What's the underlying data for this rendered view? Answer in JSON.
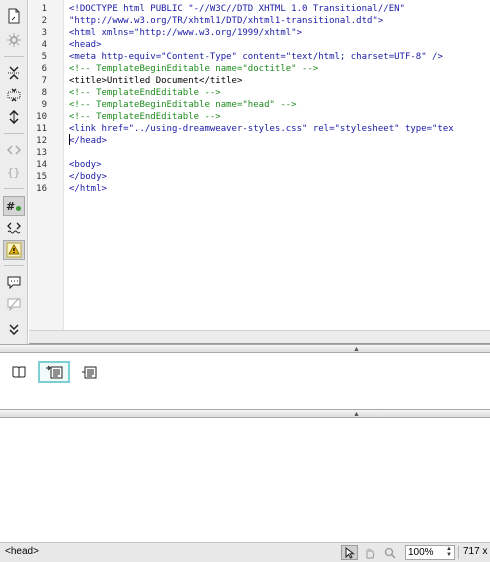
{
  "toolbar": {
    "buttons": [
      {
        "name": "open-documents-icon"
      },
      {
        "name": "show-code-navigator-icon"
      },
      {
        "name": "collapse-full-tag-icon"
      },
      {
        "name": "collapse-selection-icon"
      },
      {
        "name": "expand-all-icon"
      },
      {
        "name": "select-parent-tag-icon"
      },
      {
        "name": "balance-braces-icon"
      },
      {
        "name": "line-numbers-icon"
      },
      {
        "name": "highlight-invalid-code-icon"
      },
      {
        "name": "syntax-error-alerts-icon"
      },
      {
        "name": "apply-comment-icon"
      },
      {
        "name": "remove-comment-icon"
      },
      {
        "name": "more-options-icon"
      }
    ]
  },
  "editor": {
    "line_numbers": [
      "1",
      "2",
      "3",
      "4",
      "5",
      "6",
      "7",
      "8",
      "9",
      "10",
      "11",
      "12",
      "13",
      "14",
      "15",
      "16"
    ],
    "lines": [
      {
        "text": "<!DOCTYPE html PUBLIC \"-//W3C//DTD XHTML 1.0 Transitional//EN\"",
        "color": "blue"
      },
      {
        "text": "\"http://www.w3.org/TR/xhtml1/DTD/xhtml1-transitional.dtd\">",
        "color": "blue"
      },
      {
        "text": "<html xmlns=\"http://www.w3.org/1999/xhtml\">",
        "color": "blue"
      },
      {
        "text": "<head>",
        "color": "blue"
      },
      {
        "text": "<meta http-equiv=\"Content-Type\" content=\"text/html; charset=UTF-8\" />",
        "color": "blue"
      },
      {
        "text": "<!-- TemplateBeginEditable name=\"doctitle\" -->",
        "color": "green"
      },
      {
        "text": "<title>Untitled Document</title>",
        "color": "black"
      },
      {
        "text": "<!-- TemplateEndEditable -->",
        "color": "green"
      },
      {
        "text": "<!-- TemplateBeginEditable name=\"head\" -->",
        "color": "green"
      },
      {
        "text": "<!-- TemplateEndEditable -->",
        "color": "green"
      },
      {
        "text": "<link href=\"../using-dreamweaver-styles.css\" rel=\"stylesheet\" type=\"tex",
        "color": "blue"
      },
      {
        "text": "</head>",
        "color": "blue"
      },
      {
        "text": "",
        "color": "black"
      },
      {
        "text": "<body>",
        "color": "blue"
      },
      {
        "text": "</body>",
        "color": "blue"
      },
      {
        "text": "</html>",
        "color": "blue"
      }
    ]
  },
  "properties": {
    "buttons": [
      {
        "name": "page-properties-icon"
      },
      {
        "name": "insert-tag-icon"
      },
      {
        "name": "list-item-icon"
      }
    ]
  },
  "statusbar": {
    "tag_selector": "<head>",
    "zoom": "100%",
    "window_size": "717 x"
  },
  "colors": {
    "tag_blue": "#1a1aa6",
    "comment_green": "#1d8a1d",
    "active_outline": "#7ccfd2"
  }
}
